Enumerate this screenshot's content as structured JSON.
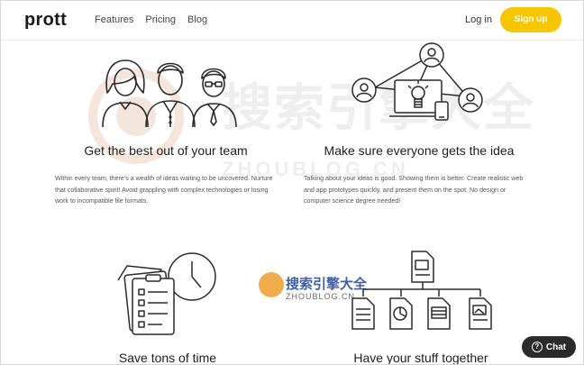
{
  "nav": {
    "logo": "prott",
    "links": [
      "Features",
      "Pricing",
      "Blog"
    ],
    "login": "Log in",
    "signup": "Sign up"
  },
  "features": [
    {
      "title": "Get the best out of your team",
      "text": "Within every team, there's a wealth of ideas waiting to be uncovered. Nurture that collaborative spirit! Avoid grappling with complex technologies or losing work to incompatible file formats.",
      "icon": "team-people-icon"
    },
    {
      "title": "Make sure everyone gets the idea",
      "text": "Talking about your ideas is good. Showing them is better. Create realistic web and app prototypes quickly, and present them on the spot. No design or computer science degree needed!",
      "icon": "network-idea-icon"
    },
    {
      "title": "Save tons of time",
      "icon": "clipboard-clock-icon"
    },
    {
      "title": "Have your stuff together",
      "icon": "document-tree-icon"
    }
  ],
  "watermark": {
    "large_text": "搜索引擎大全",
    "large_sub": "ZHOUBLOG.CN",
    "small_text": "搜索引擎大全",
    "small_sub": "ZHOUBLOG.CN"
  },
  "chat": {
    "label": "Chat",
    "icon": "question-icon"
  },
  "colors": {
    "accent": "#f6c600",
    "chat_bg": "#2b2b2b"
  }
}
